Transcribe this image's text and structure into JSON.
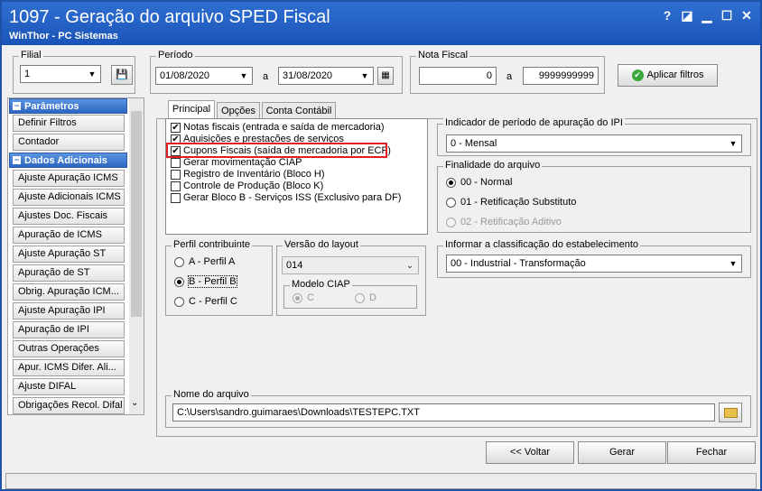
{
  "window": {
    "title": "1097 - Geração do arquivo SPED Fiscal",
    "subtitle": "WinThor - PC Sistemas",
    "controls": [
      "?",
      "◪",
      "▁",
      "☐",
      "✕"
    ]
  },
  "filters": {
    "filial_label": "Filial",
    "filial_value": "1",
    "periodo_label": "Período",
    "periodo_from": "01/08/2020",
    "periodo_sep": "a",
    "periodo_to": "31/08/2020",
    "nota_label": "Nota Fiscal",
    "nota_from": "0",
    "nota_sep": "a",
    "nota_to": "9999999999",
    "apply_label": "Aplicar filtros"
  },
  "sidebar": {
    "section1": "Parâmetros",
    "section1_items": [
      "Definir Filtros",
      "Contador"
    ],
    "section2": "Dados Adicionais",
    "section2_items": [
      "Ajuste Apuração ICMS",
      "Ajuste Adicionais ICMS",
      "Ajustes Doc. Fiscais",
      "Apuração de ICMS",
      "Ajuste Apuração ST",
      "Apuração de ST",
      "Obrig. Apuração ICM...",
      "Ajuste Apuração IPI",
      "Apuração de IPI",
      "Outras Operações",
      "Apur. ICMS Difer. Ali...",
      "Ajuste DIFAL",
      "Obrigações Recol. Difal"
    ]
  },
  "tabs": [
    "Principal",
    "Opções",
    "Conta Contábil"
  ],
  "checklist": [
    {
      "label": "Notas fiscais (entrada e saída de mercadoria)",
      "checked": true
    },
    {
      "label": "Aquisições e prestações de serviços",
      "checked": true
    },
    {
      "label": "Cupons Fiscais (saída de mercadoria por ECF)",
      "checked": true
    },
    {
      "label": "Gerar movimentação CIAP",
      "checked": false
    },
    {
      "label": "Registro de Inventário (Bloco H)",
      "checked": false
    },
    {
      "label": "Controle de Produção (Bloco K)",
      "checked": false
    },
    {
      "label": "Gerar Bloco B - Serviços ISS (Exclusivo para DF)",
      "checked": false
    }
  ],
  "ipi": {
    "label": "Indicador de período de apuração do IPI",
    "value": "0 - Mensal"
  },
  "finalidade": {
    "label": "Finalidade do arquivo",
    "options": [
      "00 - Normal",
      "01 - Retificação Substituto",
      "02 - Retificação Aditivo"
    ]
  },
  "perfil": {
    "label": "Perfil contribuinte",
    "options": [
      "A - Perfil A",
      "B - Perfil B",
      "C - Perfil C"
    ]
  },
  "layout": {
    "label": "Versão do layout",
    "value": "014",
    "ciap_label": "Modelo CIAP",
    "ciap_options": [
      "C",
      "D"
    ]
  },
  "classificacao": {
    "label": "Informar a classificação do estabelecimento",
    "value": "00 - Industrial - Transformação"
  },
  "arquivo": {
    "label": "Nome do arquivo",
    "value": "C:\\Users\\sandro.guimaraes\\Downloads\\TESTEPC.TXT"
  },
  "footer": {
    "back": "<< Voltar",
    "generate": "Gerar",
    "close": "Fechar"
  }
}
